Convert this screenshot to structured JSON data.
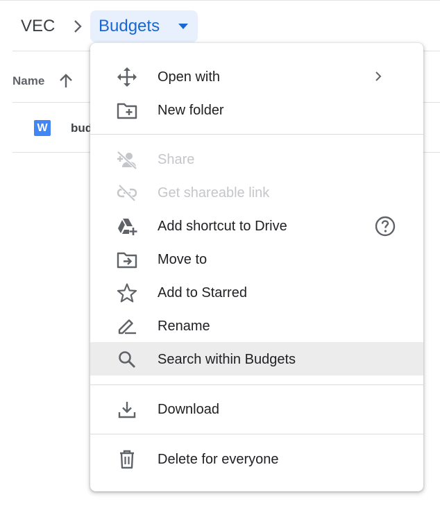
{
  "breadcrumb": {
    "root": "VEC",
    "current": "Budgets"
  },
  "file_list": {
    "column_header": "Name",
    "sort_icon": "arrow-up-icon",
    "rows": [
      {
        "icon_letter": "W",
        "name": "budgets",
        "icon": "word-doc-icon"
      }
    ]
  },
  "menu": {
    "open_with": "Open with",
    "new_folder": "New folder",
    "share": "Share",
    "get_link": "Get shareable link",
    "add_shortcut": "Add shortcut to Drive",
    "move_to": "Move to",
    "add_starred": "Add to Starred",
    "rename": "Rename",
    "search_within": "Search within Budgets",
    "download": "Download",
    "delete": "Delete for everyone"
  },
  "colors": {
    "accent": "#1967d2",
    "breadcrumb_highlight": "#e8f0fe",
    "icon_gray": "#5f6368",
    "disabled_text": "#c4c6c9",
    "hover_row": "#ececec",
    "word_blue": "#4285f4"
  }
}
